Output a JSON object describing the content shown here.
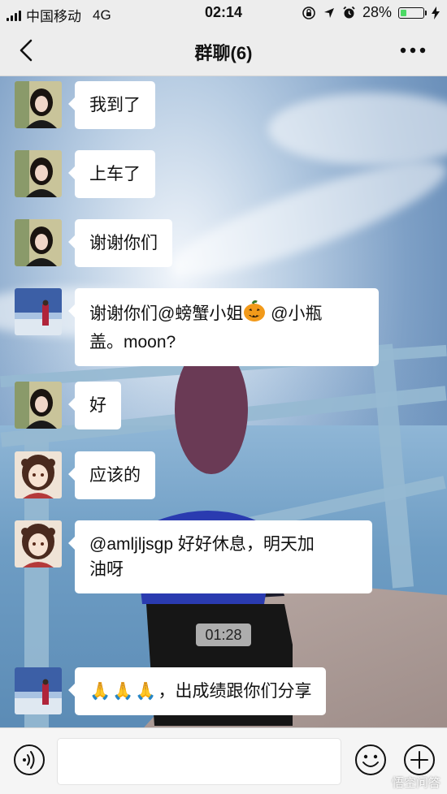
{
  "status_bar": {
    "carrier": "中国移动",
    "network": "4G",
    "time": "02:14",
    "battery_percent": "28%",
    "battery_level": 0.28,
    "battery_color": "#4cd964"
  },
  "nav": {
    "title": "群聊(6)",
    "back_icon": "chevron-left-icon",
    "more_icon": "ellipsis-icon"
  },
  "messages": [
    {
      "sender_avatar": "girl-photo-avatar",
      "text": "我到了"
    },
    {
      "sender_avatar": "girl-photo-avatar",
      "text": "上车了"
    },
    {
      "sender_avatar": "girl-photo-avatar",
      "text": "谢谢你们"
    },
    {
      "sender_avatar": "seaside-photo-avatar",
      "text_part1": "谢谢你们@螃蟹小姐",
      "emoji": "🎃",
      "text_part2": " @小瓶",
      "text_line2": "盖。moon?"
    },
    {
      "sender_avatar": "girl-photo-avatar",
      "text": "好"
    },
    {
      "sender_avatar": "anime-girl-avatar",
      "text": "应该的"
    },
    {
      "sender_avatar": "anime-girl-avatar",
      "text_line1": "@amljljsgp 好好休息，明天加",
      "text_line2": "油呀"
    },
    {
      "sender_avatar": "seaside-photo-avatar",
      "emojis": "🙏🙏🙏",
      "text": "，出成绩跟你们分享"
    }
  ],
  "time_divider": "01:28",
  "input_bar": {
    "voice_icon": "voice-icon",
    "emoji_icon": "smiley-icon",
    "plus_icon": "plus-circle-icon"
  },
  "watermark": "悟空问答",
  "colors": {
    "bubble": "#ffffff",
    "nav_background": "#ededed"
  }
}
